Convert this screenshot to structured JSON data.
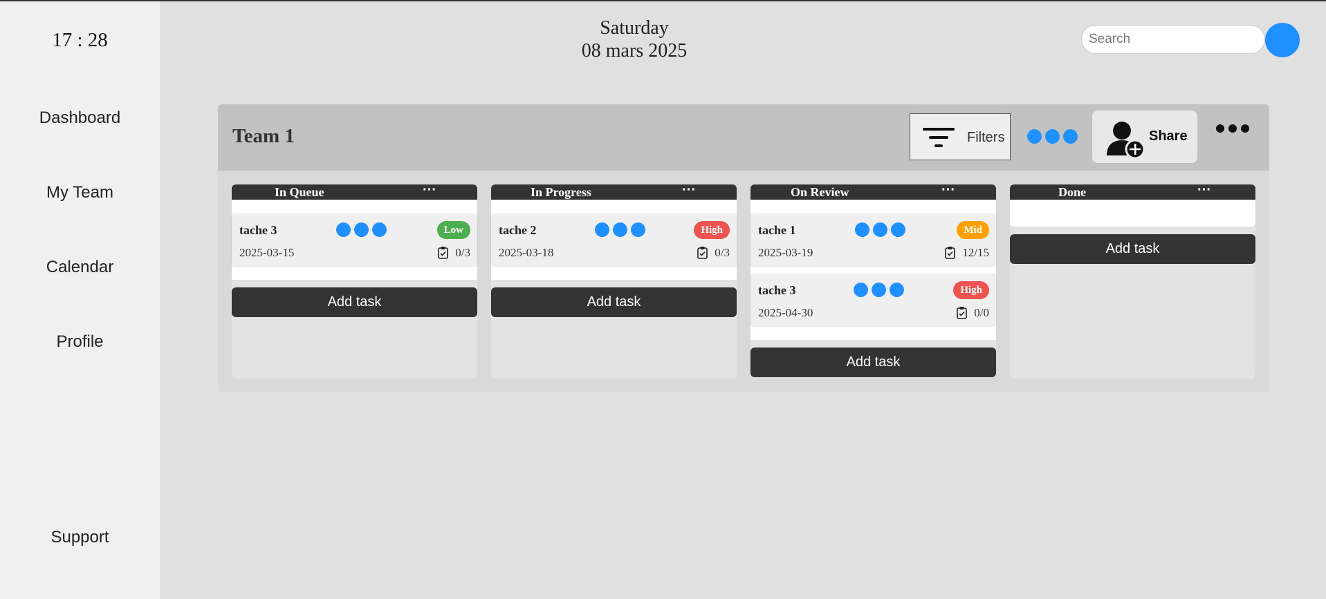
{
  "clock": "17 : 28",
  "sidebar": {
    "items": [
      {
        "label": "Dashboard"
      },
      {
        "label": "My Team"
      },
      {
        "label": "Calendar"
      },
      {
        "label": "Profile"
      }
    ],
    "support": "Support"
  },
  "header": {
    "day": "Saturday",
    "date": "08 mars 2025",
    "search_placeholder": "Search"
  },
  "board": {
    "title": "Team 1",
    "filters_label": "Filters",
    "share_label": "Share",
    "add_task_label": "Add task",
    "columns": [
      {
        "title": "In Queue",
        "tasks": [
          {
            "name": "tache 3",
            "priority": "Low",
            "priority_color": "#4caf50",
            "date": "2025-03-15",
            "progress": "0/3"
          }
        ]
      },
      {
        "title": "In Progress",
        "tasks": [
          {
            "name": "tache 2",
            "priority": "High",
            "priority_color": "#ef5350",
            "date": "2025-03-18",
            "progress": "0/3"
          }
        ]
      },
      {
        "title": "On Review",
        "tasks": [
          {
            "name": "tache 1",
            "priority": "Mid",
            "priority_color": "#ffa000",
            "date": "2025-03-19",
            "progress": "12/15"
          },
          {
            "name": "tache 3",
            "priority": "High",
            "priority_color": "#ef5350",
            "date": "2025-04-30",
            "progress": "0/0"
          }
        ]
      },
      {
        "title": "Done",
        "tasks": []
      }
    ]
  },
  "colors": {
    "accent": "#1e90ff",
    "dark": "#333333"
  }
}
